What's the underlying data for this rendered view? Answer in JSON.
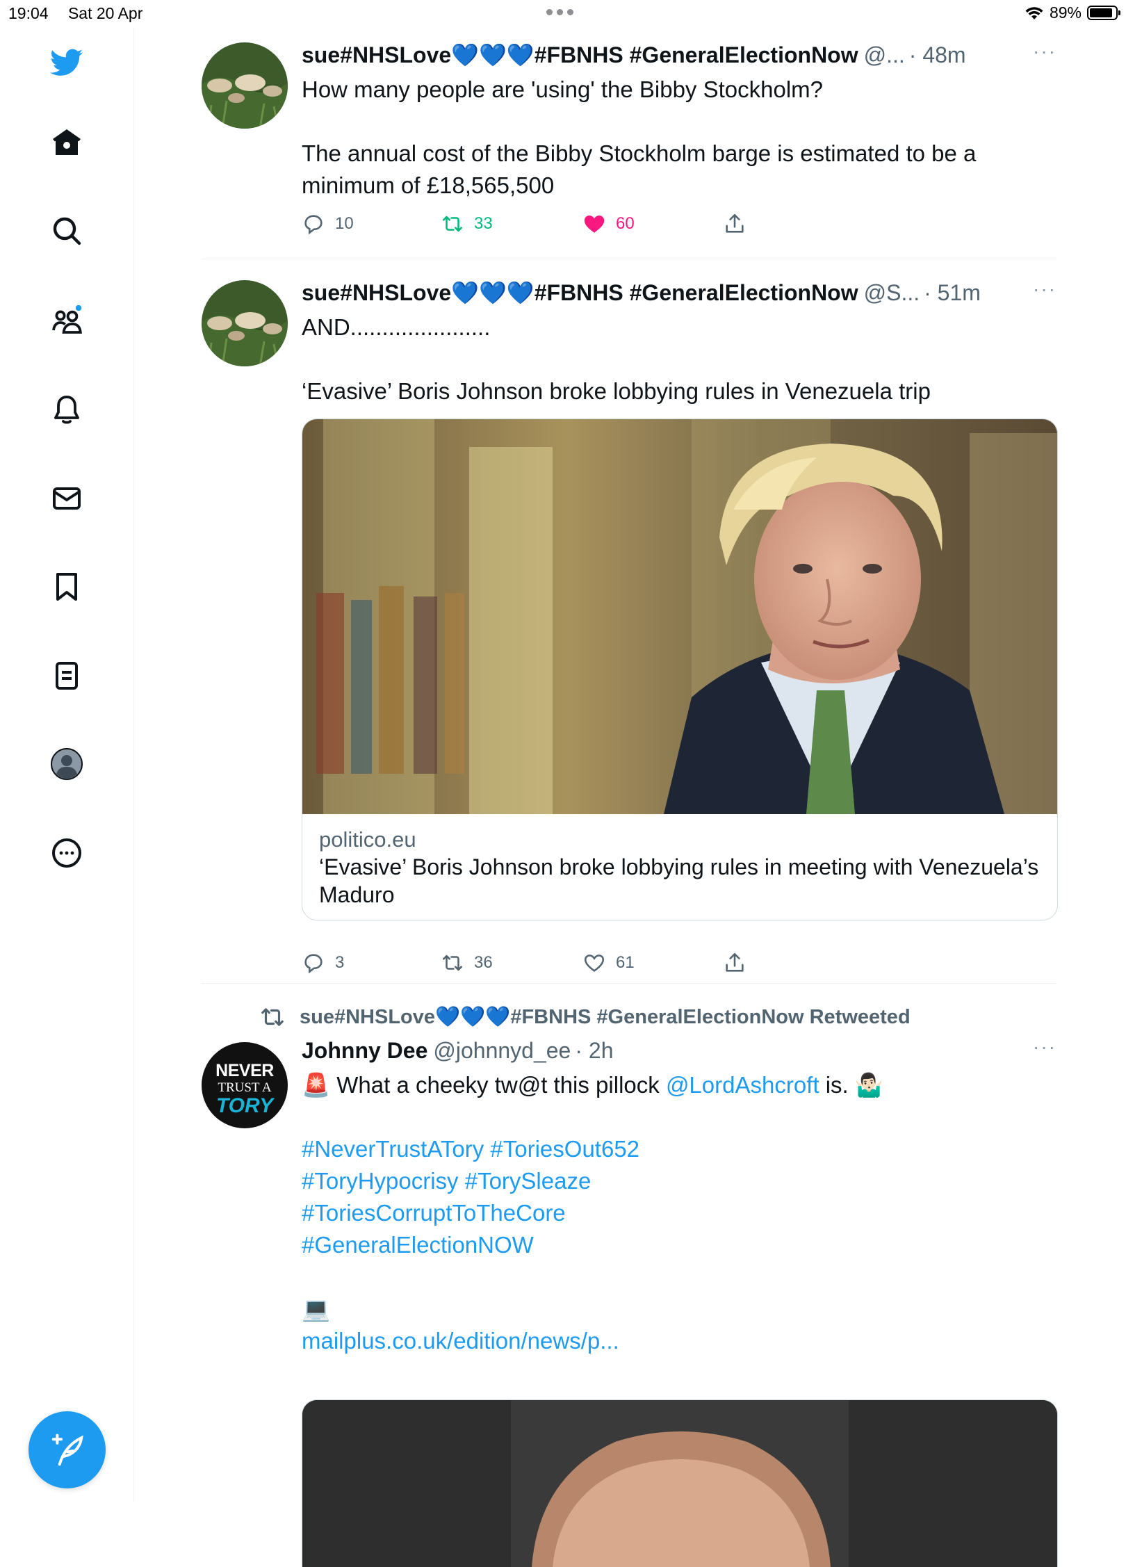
{
  "status_bar": {
    "time": "19:04",
    "date": "Sat 20 Apr",
    "battery": "89%",
    "battery_level": 0.89
  },
  "sidebar": {
    "items": [
      {
        "icon": "twitter-bird-icon"
      },
      {
        "icon": "home-icon"
      },
      {
        "icon": "search-icon"
      },
      {
        "icon": "communities-icon"
      },
      {
        "icon": "notifications-bell-icon"
      },
      {
        "icon": "messages-envelope-icon"
      },
      {
        "icon": "bookmark-icon"
      },
      {
        "icon": "lists-icon"
      },
      {
        "icon": "profile-avatar-icon"
      },
      {
        "icon": "more-circle-icon"
      }
    ],
    "compose_icon": "compose-feather-icon"
  },
  "tweets": [
    {
      "name": "sue#NHSLove💙💙💙#FBNHS #GeneralElectionNow",
      "handle": "@...",
      "time": "· 48m",
      "more": "···",
      "text": "How many people are 'using' the Bibby Stockholm?\n\nThe annual cost of the Bibby Stockholm barge is estimated to be a minimum of £18,565,500",
      "replies": "10",
      "retweets": "33",
      "likes": "60",
      "liked": true,
      "retweeted": true
    },
    {
      "name": "sue#NHSLove💙💙💙#FBNHS #GeneralElectionNow",
      "handle": "@S...",
      "time": "· 51m",
      "more": "···",
      "text": "AND......................\n\n‘Evasive’ Boris Johnson broke lobbying rules in Venezuela trip",
      "card": {
        "domain": "politico.eu",
        "title": "‘Evasive’ Boris Johnson broke lobbying rules in meeting with Venezuela’s Maduro"
      },
      "replies": "3",
      "retweets": "36",
      "likes": "61"
    },
    {
      "retweeted_by": "sue#NHSLove💙💙💙#FBNHS #GeneralElectionNow Retweeted",
      "name": "Johnny Dee",
      "handle": "@johnnyd_ee",
      "time": "· 2h",
      "more": "···",
      "avatar_text": {
        "line1": "NEVER",
        "line2": "TRUST A",
        "line3": "TORY"
      },
      "text_start": "🚨 What a cheeky tw@t this pillock ",
      "mention": "@LordAshcroft",
      "text_end": " is. 🤷🏻‍♂️",
      "hashtags": "#NeverTrustATory #ToriesOut652\n#ToryHypocrisy #TorySleaze\n#ToriesCorruptToTheCore\n#GeneralElectionNOW",
      "laptop_emoji": "💻",
      "link": "mailplus.co.uk/edition/news/p..."
    }
  ],
  "colors": {
    "accent": "#1d9bf0",
    "like": "#f91880",
    "retweet": "#00ba7c",
    "muted": "#536471"
  }
}
